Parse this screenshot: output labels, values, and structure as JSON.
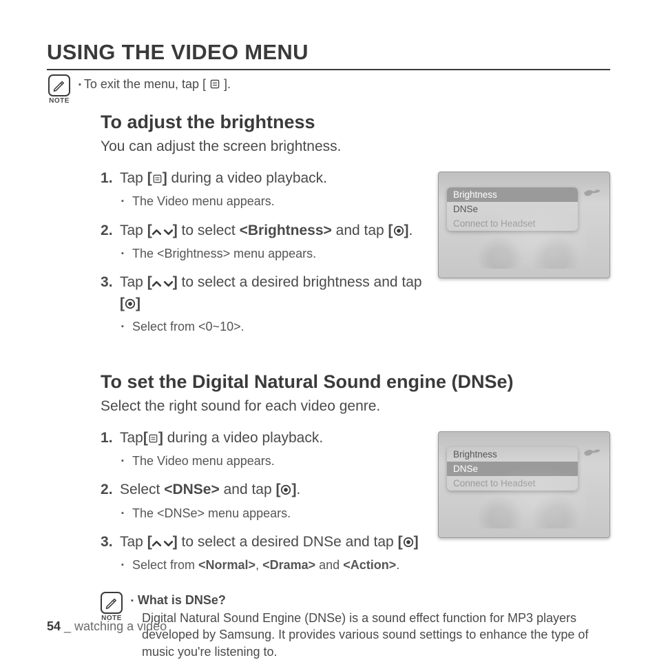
{
  "page_title": "USING THE VIDEO MENU",
  "top_note": {
    "label": "NOTE",
    "text_before": "To exit the menu, tap [",
    "text_after": "]."
  },
  "section_brightness": {
    "heading": "To adjust the brightness",
    "intro": "You can adjust the screen brightness.",
    "step1_a": "Tap ",
    "step1_b": " during a video playback.",
    "step1_bullet": "The Video menu appears.",
    "step2_a": "Tap ",
    "step2_b": " to select ",
    "step2_target": "<Brightness>",
    "step2_c": " and tap ",
    "step2_d": ".",
    "step2_bullet": "The <Brightness> menu appears.",
    "step3_a": "Tap ",
    "step3_b": " to select a desired brightness and tap ",
    "step3_bullet": "Select from <0~10>.",
    "screenshot": {
      "items": [
        "Brightness",
        "DNSe",
        "Connect to Headset"
      ],
      "selected_index": 0
    }
  },
  "section_dnse": {
    "heading": "To set the Digital Natural Sound engine (DNSe)",
    "intro": "Select the right sound for each video genre.",
    "step1_a": "Tap",
    "step1_b": " during a video playback.",
    "step1_bullet": "The Video menu appears.",
    "step2_a": "Select ",
    "step2_target": "<DNSe>",
    "step2_b": " and tap ",
    "step2_c": ".",
    "step2_bullet": "The <DNSe> menu appears.",
    "step3_a": "Tap ",
    "step3_b": " to select a desired DNSe and tap ",
    "step3_bullet_a": "Select from ",
    "step3_opts": [
      "<Normal>",
      "<Drama>",
      "<Action>"
    ],
    "step3_bullet_b": ".",
    "screenshot": {
      "items": [
        "Brightness",
        "DNSe",
        "Connect to Headset"
      ],
      "selected_index": 1
    }
  },
  "dnse_note": {
    "label": "NOTE",
    "question": "What is DNSe?",
    "body": "Digital Natural Sound Engine (DNSe) is a sound effect function for MP3 players developed by Samsung. It provides various sound settings to enhance the type of music you're listening to."
  },
  "footer": {
    "page": "54",
    "sep": " _ ",
    "chapter": "watching a video"
  },
  "glyph_labels": {
    "menu": "[ ⊟ ]",
    "updown": "[ ⌃ ⌄ ]",
    "select": "[ ◉ ]"
  }
}
